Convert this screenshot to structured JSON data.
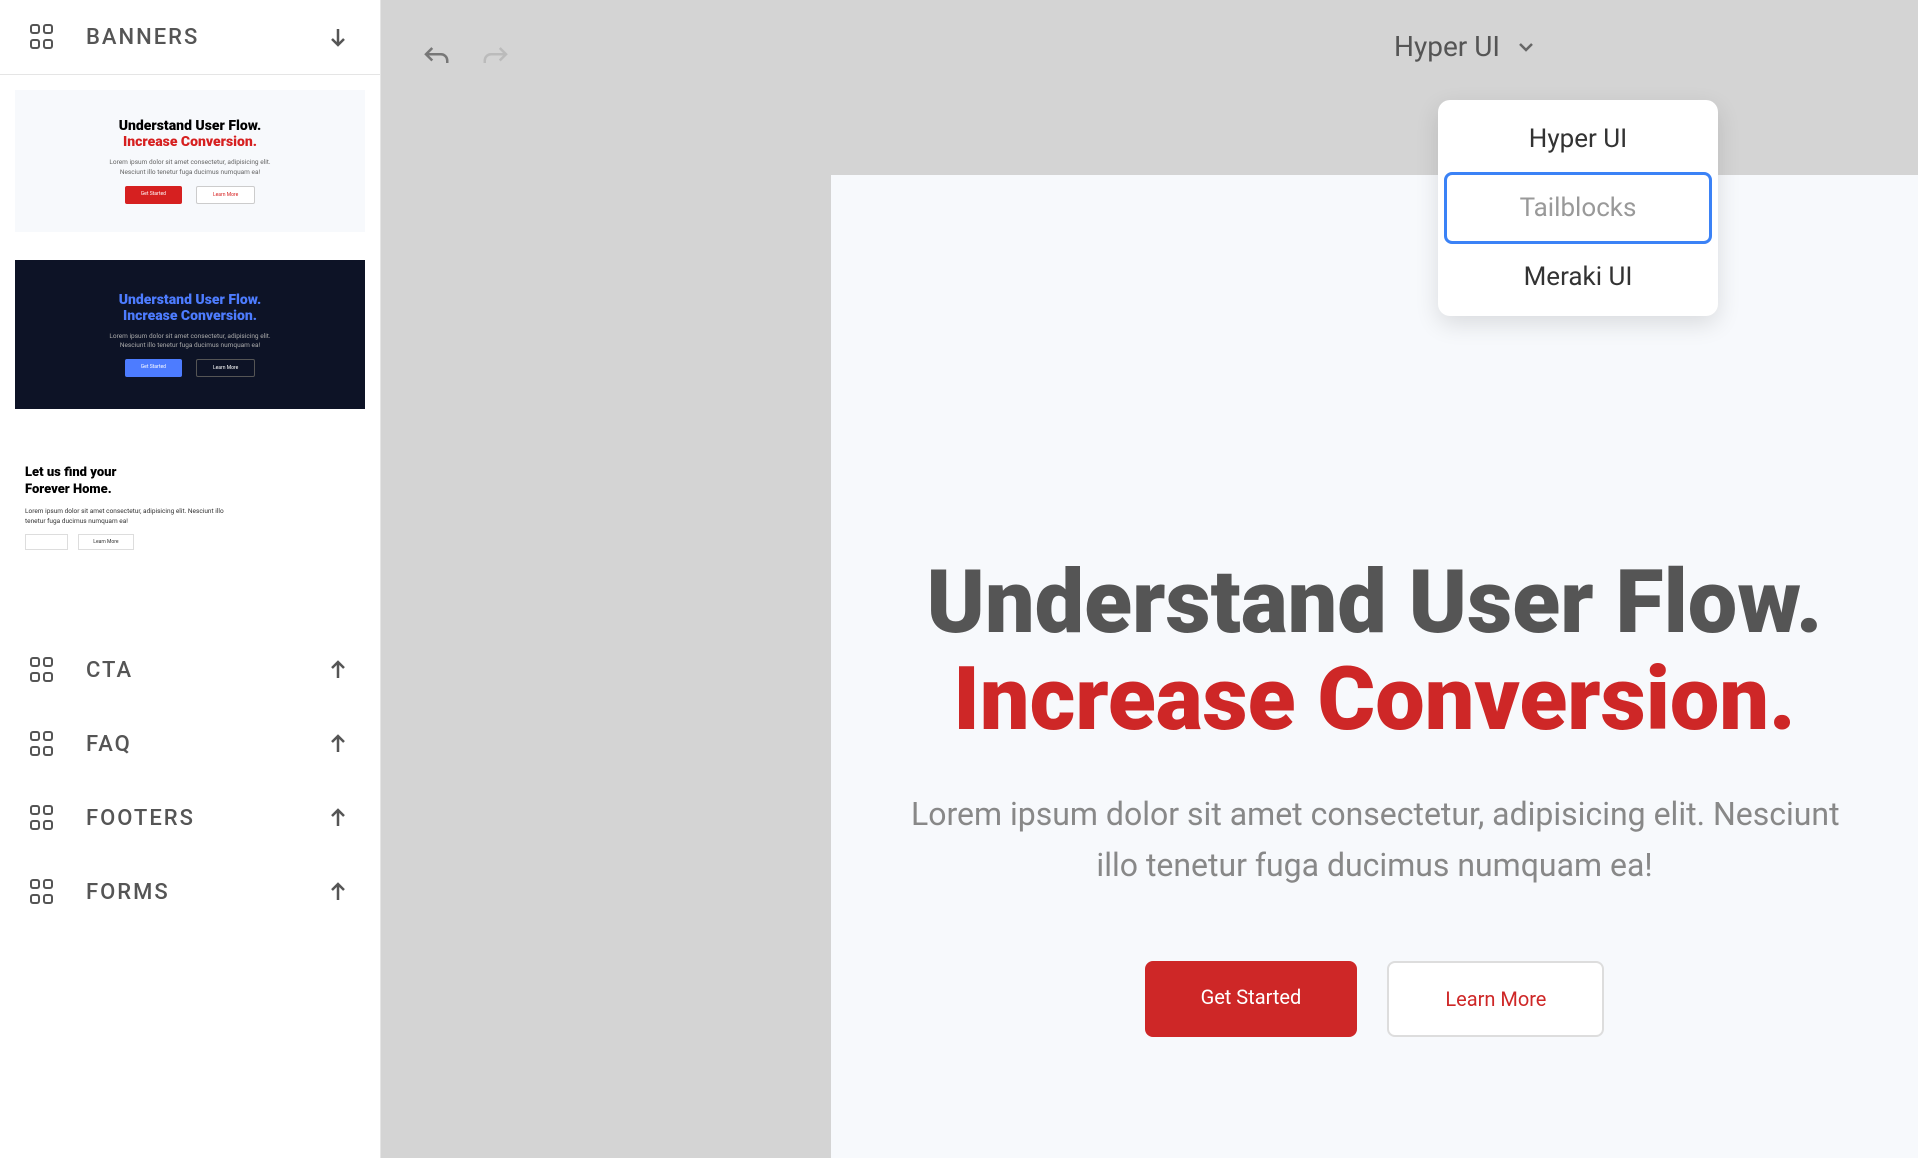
{
  "sidebar": {
    "sections": [
      {
        "title": "BANNERS",
        "expanded": true
      },
      {
        "title": "CTA",
        "expanded": false
      },
      {
        "title": "FAQ",
        "expanded": false
      },
      {
        "title": "FOOTERS",
        "expanded": false
      },
      {
        "title": "FORMS",
        "expanded": false
      }
    ],
    "banner_previews": [
      {
        "line1": "Understand User Flow.",
        "line2": "Increase Conversion.",
        "desc": "Lorem ipsum dolor sit amet consectetur, adipisicing elit. Nesciunt illo tenetur fuga ducimus numquam ea!",
        "btn1": "Get Started",
        "btn2": "Learn More"
      },
      {
        "line1": "Understand User Flow.",
        "line2": "Increase Conversion.",
        "desc": "Lorem ipsum dolor sit amet consectetur, adipisicing elit. Nesciunt illo tenetur fuga ducimus numquam ea!",
        "btn1": "Get Started",
        "btn2": "Learn More"
      },
      {
        "line1": "Let us find your",
        "line2": "Forever Home.",
        "desc": "Lorem ipsum dolor sit amet consectetur, adipisicing elit. Nesciunt illo tenetur fuga ducimus numquam ea!",
        "btn2": "Learn More"
      }
    ]
  },
  "toolbar": {
    "library_dropdown": {
      "selected": "Hyper UI",
      "options": [
        "Hyper UI",
        "Tailblocks",
        "Meraki UI"
      ],
      "focused_index": 1
    }
  },
  "canvas": {
    "heading1": "Understand User Flow.",
    "heading2": "Increase Conversion.",
    "desc_line1": "Lorem ipsum dolor sit amet consectetur, adipisicing elit. Nesciunt",
    "desc_line2": "illo tenetur fuga ducimus numquam ea!",
    "btn1": "Get Started",
    "btn2": "Learn More"
  }
}
